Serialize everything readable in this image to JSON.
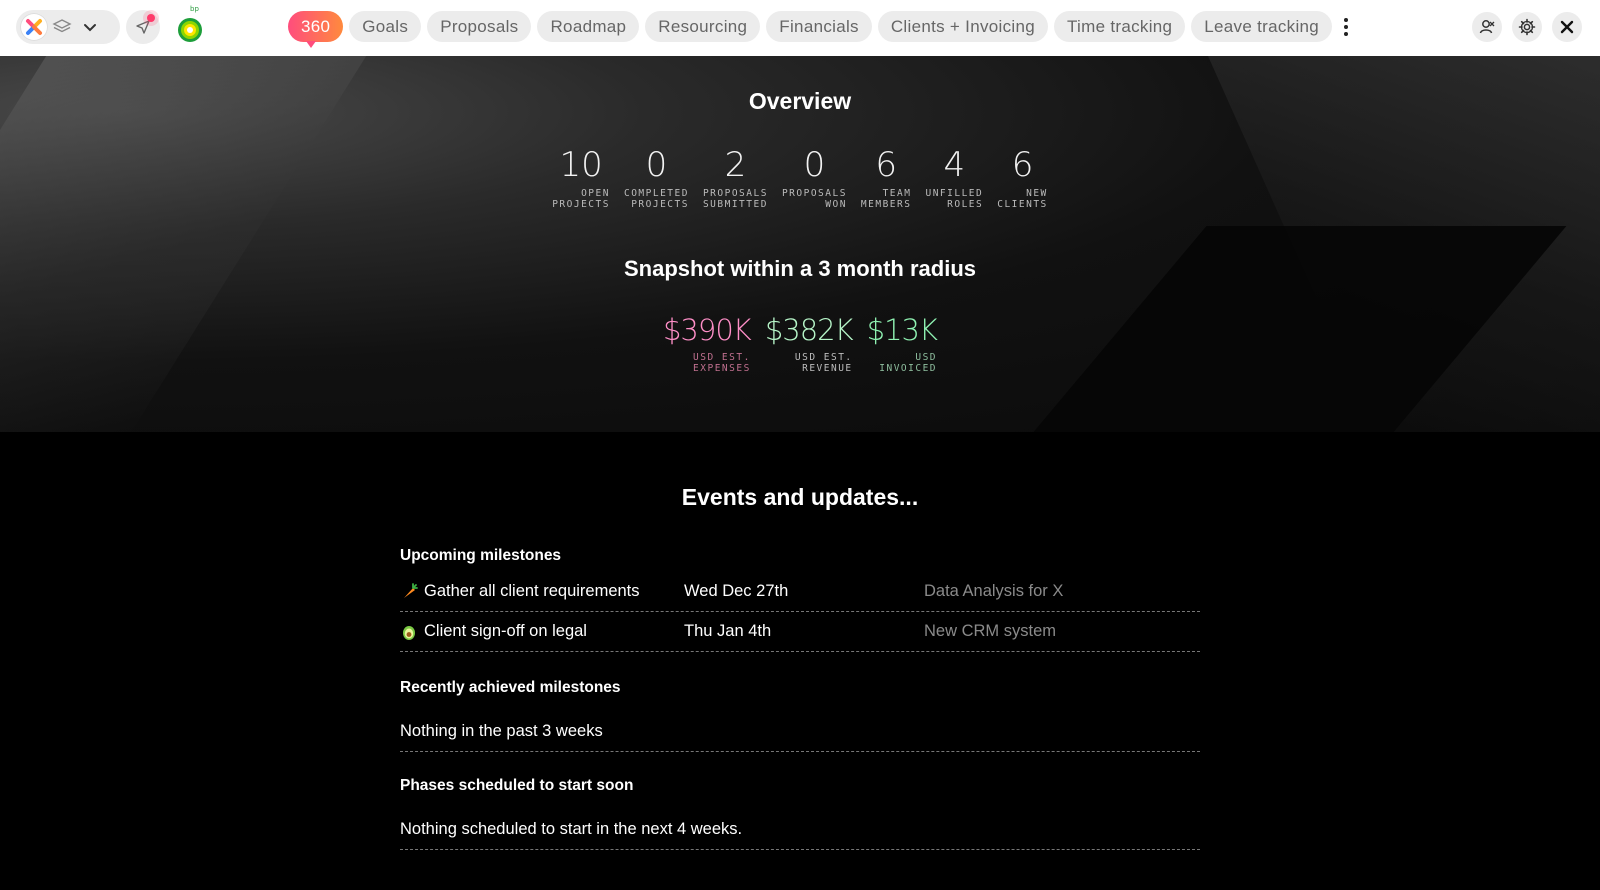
{
  "nav": {
    "tabs": [
      "360",
      "Goals",
      "Proposals",
      "Roadmap",
      "Resourcing",
      "Financials",
      "Clients + Invoicing",
      "Time tracking",
      "Leave tracking"
    ],
    "active_tab": "360",
    "logo_tag": "bp"
  },
  "overview": {
    "title": "Overview",
    "stats": [
      {
        "value": "10",
        "label1": "Open",
        "label2": "projects"
      },
      {
        "value": "0",
        "label1": "Completed",
        "label2": "projects"
      },
      {
        "value": "2",
        "label1": "Proposals",
        "label2": "submitted"
      },
      {
        "value": "0",
        "label1": "Proposals",
        "label2": "won"
      },
      {
        "value": "6",
        "label1": "Team",
        "label2": "members"
      },
      {
        "value": "4",
        "label1": "Unfilled",
        "label2": "roles"
      },
      {
        "value": "6",
        "label1": "New",
        "label2": "clients"
      }
    ]
  },
  "snapshot": {
    "title": "Snapshot within a 3 month radius",
    "items": [
      {
        "value": "$390K",
        "label1": "USD est.",
        "label2": "expenses",
        "color": "#ff8fc8",
        "label_color": "#c0708f"
      },
      {
        "value": "$382K",
        "label1": "USD est.",
        "label2": "revenue",
        "color": "#b6f5c8",
        "label_color": "#bdbdbd"
      },
      {
        "value": "$13K",
        "label1": "USD",
        "label2": "invoiced",
        "color": "#8ff2b2",
        "label_color": "#8fbf9f"
      }
    ]
  },
  "events": {
    "title": "Events and updates...",
    "upcoming_title": "Upcoming milestones",
    "upcoming": [
      {
        "icon": "carrot-icon",
        "name": "Gather all client requirements",
        "date": "Wed Dec 27th",
        "project": "Data Analysis for X"
      },
      {
        "icon": "avocado-icon",
        "name": "Client sign-off on legal",
        "date": "Thu Jan 4th",
        "project": "New CRM system"
      }
    ],
    "recent_title": "Recently achieved milestones",
    "recent_empty": "Nothing in the past 3 weeks",
    "phases_title": "Phases scheduled to start soon",
    "phases_empty": "Nothing scheduled to start in the next 4 weeks."
  }
}
